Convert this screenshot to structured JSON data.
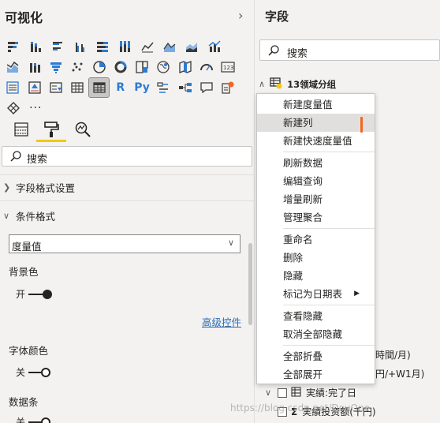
{
  "visualizations": {
    "title": "可视化",
    "collapse_icon": "chevron-right-icon",
    "icon_rows": [
      [
        "stacked-bar-chart-icon",
        "stacked-column-chart-icon",
        "clustered-bar-chart-icon",
        "clustered-column-chart-icon",
        "100-stacked-bar-chart-icon",
        "100-stacked-column-chart-icon",
        "line-chart-icon",
        "area-chart-icon",
        "stacked-area-chart-icon",
        "line-and-column-chart-icon"
      ],
      [
        "line-and-stacked-column-chart-icon",
        "ribbon-chart-icon",
        "funnel-chart-icon",
        "scatter-chart-icon",
        "pie-chart-icon",
        "donut-chart-icon",
        "treemap-icon",
        "map-icon",
        "filled-map-icon",
        "gauge-icon",
        "card-icon"
      ],
      [
        "multi-row-card-icon",
        "kpi-icon",
        "slicer-icon",
        "table-icon",
        "matrix-icon",
        "r-visual-icon",
        "python-visual-icon",
        "key-influencers-icon",
        "decomposition-tree-icon",
        "qa-icon",
        "smart-narrative-icon"
      ],
      [
        "arcgis-map-icon",
        "more-visuals-icon"
      ]
    ],
    "r_label": "R",
    "py_label": "Py",
    "more_label": "···",
    "format_tabs": [
      "fields-tab-icon",
      "format-paint-roller-icon",
      "analytics-magnifier-icon"
    ],
    "search": {
      "placeholder": "搜索"
    },
    "field_formatting_label": "字段格式设置",
    "conditional_formatting_label": "条件格式",
    "dropdown_value": "度量值",
    "background_color_label": "背景色",
    "background_toggle_label": "开",
    "advanced_controls_label": "高级控件",
    "font_color_label": "字体颜色",
    "font_toggle_label": "关",
    "data_bars_label": "数据条",
    "data_bars_toggle_label": "关"
  },
  "fields": {
    "title": "字段",
    "search": {
      "placeholder": "搜索"
    },
    "table_name": "13领域分组",
    "behind_text_1": "時間/月)",
    "behind_text_2": "円/+W1月)",
    "rows": [
      {
        "label": "実績:完了日"
      },
      {
        "label": "実績投资额(千円)"
      }
    ]
  },
  "context_menu": {
    "groups": [
      [
        "新建度量值",
        "新建列",
        "新建快速度量值"
      ],
      [
        "刷新数据",
        "编辑查询",
        "增量刷新",
        "管理聚合"
      ],
      [
        "重命名",
        "删除",
        "隐藏",
        "标记为日期表"
      ],
      [
        "查看隐藏",
        "取消全部隐藏"
      ],
      [
        "全部折叠",
        "全部展开"
      ]
    ],
    "highlighted_item": "新建列",
    "submenu_item": "标记为日期表"
  },
  "watermark": "https://blog.csdn.net/DouOne",
  "colors": {
    "accent_yellow": "#f2c811",
    "highlight_marker": "#f26522",
    "link_blue": "#2b6cb6"
  }
}
